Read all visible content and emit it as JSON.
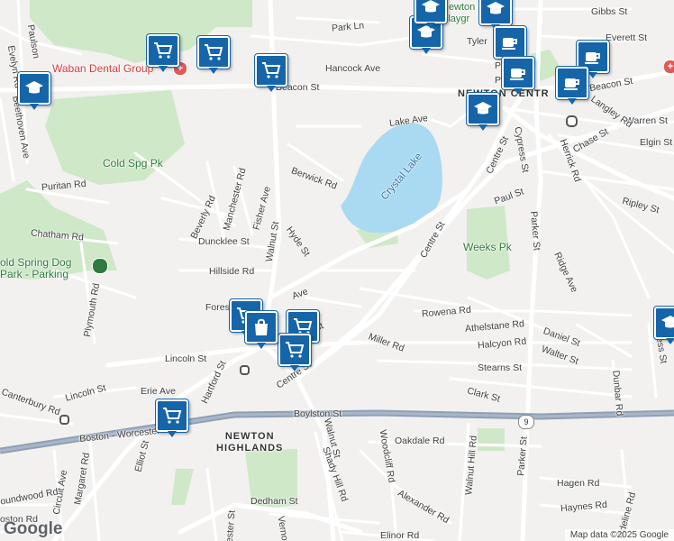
{
  "map": {
    "streets": {
      "park_ln": "Park Ln",
      "gibbs_st": "Gibbs St",
      "everett_st": "Everett St",
      "hancock_ave": "Hancock Ave",
      "beacon_st_left": "Beacon St",
      "beacon_st_right": "Beacon St",
      "lake_ave": "Lake Ave",
      "warren_st": "Warren St",
      "langley_rd": "Langley Rd",
      "chase_st": "Chase St",
      "elgin_st": "Elgin St",
      "herrick_rd": "Herrick Rd",
      "cypress_st": "Cypress St",
      "centre_st_upper": "Centre St",
      "centre_st_mid": "Centre St",
      "centre_st_lower": "Centre St",
      "berwick_rd": "Berwick Rd",
      "paul_st": "Paul St",
      "ripley_st": "Ripley St",
      "puritan_rd": "Puritan Rd",
      "beverly_rd": "Beverly Rd",
      "manchester_rd": "Manchester Rd",
      "fisher_ave": "Fisher Ave",
      "walnut_st_upper": "Walnut St",
      "walnut_st_lower": "Walnut St",
      "hyde_st": "Hyde St",
      "duncklee_st": "Duncklee St",
      "chatham_rd": "Chatham Rd",
      "parker_st_upper": "Parker St",
      "parker_st_lower": "Parker St",
      "ridge_ave": "Ridge Ave",
      "hillside_rd": "Hillside Rd",
      "plymouth_rd": "Plymouth Rd",
      "forest_ave": "Fores",
      "ave_suffix": "Ave",
      "st_suffix": "St",
      "rowena_rd": "Rowena Rd",
      "athelstane_rd": "Athelstane Rd",
      "daniel_st": "Daniel St",
      "miller_rd": "Miller Rd",
      "halcyon_rd": "Halcyon Rd",
      "lincoln_st_upper": "Lincoln St",
      "lincoln_st_lower": "Lincoln St",
      "stearns_st": "Stearns St",
      "walter_st": "Walter St",
      "hartford_st": "Hartford St",
      "erie_ave": "Erie Ave",
      "canterbury_rd": "Canterbury Rd",
      "clark_st": "Clark St",
      "dunbar_rd": "Dunbar Rd",
      "boylston_st": "Boylston St",
      "boston_worcester_tpke": "Boston - Worcester Tpke",
      "elliot_st": "Elliot St",
      "oakdale_rd": "Oakdale Rd",
      "margaret_rd": "Margaret Rd",
      "circuit_ave": "Circuit Ave",
      "woodcliff_rd": "Woodcliff Rd",
      "walnut_hill_rd": "Walnut Hill Rd",
      "shady_hill_rd": "Shady Hill Rd",
      "hagen_rd": "Hagen Rd",
      "haynes_rd": "Haynes Rd",
      "dedham_st": "Dedham St",
      "alexander_rd": "Alexander Rd",
      "adeline_rd": "Adeline Rd",
      "elinor_rd": "Elinor Rd",
      "paulson": "Paulson",
      "evelyn_rd": "Evelyn Rd",
      "beethoven_ave": "Beethoven Ave",
      "sherwood_rd": "oundwood Rd",
      "boston_rd": "oston Rd",
      "chester_st": "ester St",
      "vernon_st": "Verno",
      "express_st": "press St",
      "pelham": "Pelham",
      "pleasant": "Pleasan",
      "tyler": "Tyler"
    },
    "places": {
      "waban_dental": "Waban Dental Group",
      "cold_spg_pk": "Cold Spg Pk",
      "crystal_lake": "Crystal Lake",
      "weeks_pk": "Weeks Pk",
      "dog_park": "old Spring Dog\nPark - Parking",
      "newton_centre": "NEWTON CENTR",
      "newton_highlands": "NEWTON\nHIGHLANDS",
      "newton_playground": "Newton\nPlaygr"
    },
    "route_shield": "9",
    "google_logo": "Google",
    "attribution": "Map data ©2025 Google",
    "markers": [
      {
        "type": "school-icon"
      },
      {
        "type": "school-icon"
      },
      {
        "type": "school-icon"
      },
      {
        "type": "school-icon"
      },
      {
        "type": "school-icon"
      },
      {
        "type": "school-icon"
      },
      {
        "type": "cafe-icon"
      },
      {
        "type": "cafe-icon"
      },
      {
        "type": "cafe-icon"
      },
      {
        "type": "cafe-icon"
      },
      {
        "type": "shopping-cart-icon"
      },
      {
        "type": "shopping-cart-icon"
      },
      {
        "type": "shopping-cart-icon"
      },
      {
        "type": "shopping-cart-icon"
      },
      {
        "type": "shopping-cart-icon"
      },
      {
        "type": "shopping-cart-icon"
      },
      {
        "type": "shopping-cart-icon"
      },
      {
        "type": "shopping-bag-icon"
      }
    ],
    "colors": {
      "road": "#ffffff",
      "highway": "#8ea0b8",
      "park": "#cfe8c8",
      "water": "#a9daf1",
      "marker": "#1565a8",
      "background": "#f2f1ef"
    }
  }
}
